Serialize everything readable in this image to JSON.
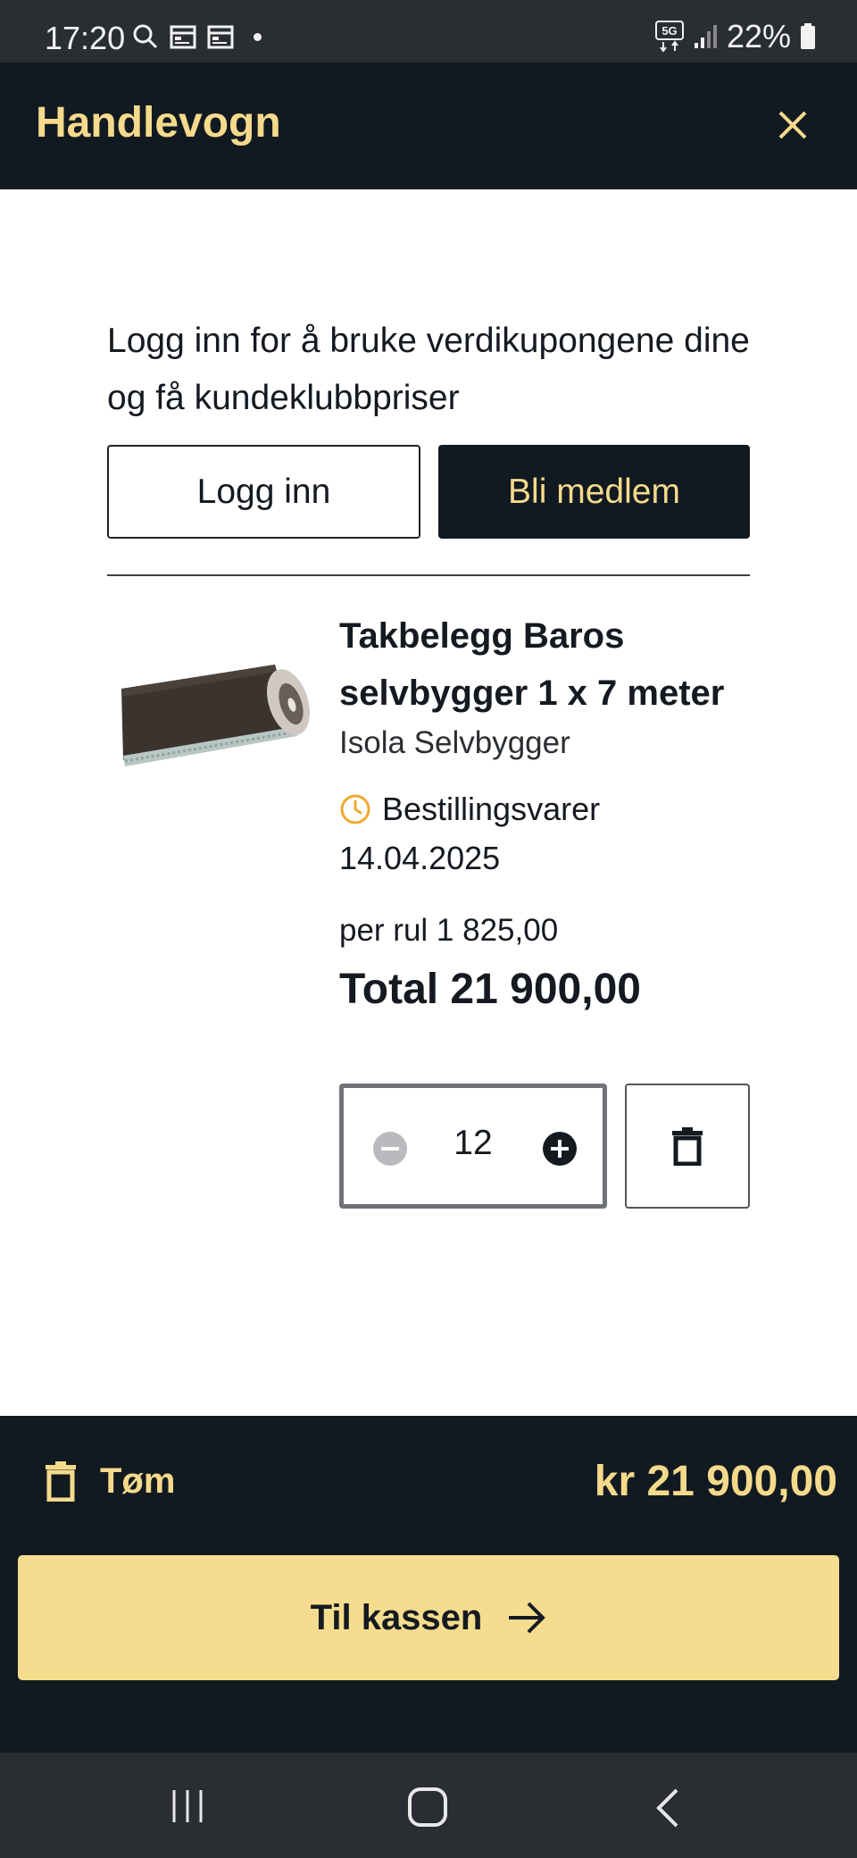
{
  "status_bar": {
    "time": "17:20",
    "battery": "22%",
    "network": "5G",
    "icons": [
      "search-icon",
      "calendar-icon",
      "calendar-icon",
      "dot-icon",
      "5g-icon",
      "signal-icon",
      "battery-icon"
    ]
  },
  "header": {
    "title": "Handlevogn",
    "close_icon": "close-icon"
  },
  "login": {
    "prompt": "Logg inn for å bruke verdikupongene dine og få kundeklubbpriser",
    "login_button": "Logg inn",
    "member_button": "Bli medlem"
  },
  "product": {
    "name": "Takbelegg Baros selvbygger 1 x 7 meter",
    "brand": "Isola Selvbygger",
    "availability": "Bestillingsvarer",
    "availability_date": "14.04.2025",
    "unit_price": "per rul 1 825,00",
    "total": "Total 21 900,00",
    "quantity": "12",
    "image_icon": "roofing-roll-image"
  },
  "footer": {
    "empty_label": "Tøm",
    "cart_total": "kr 21 900,00",
    "checkout_label": "Til kassen"
  },
  "colors": {
    "dark": "#121a21",
    "accent": "#f6da8c",
    "checkout_bg": "#f6dc8e",
    "clock": "#f0a830"
  },
  "nav": {
    "icons": [
      "recent-apps-icon",
      "home-icon",
      "back-icon"
    ]
  }
}
